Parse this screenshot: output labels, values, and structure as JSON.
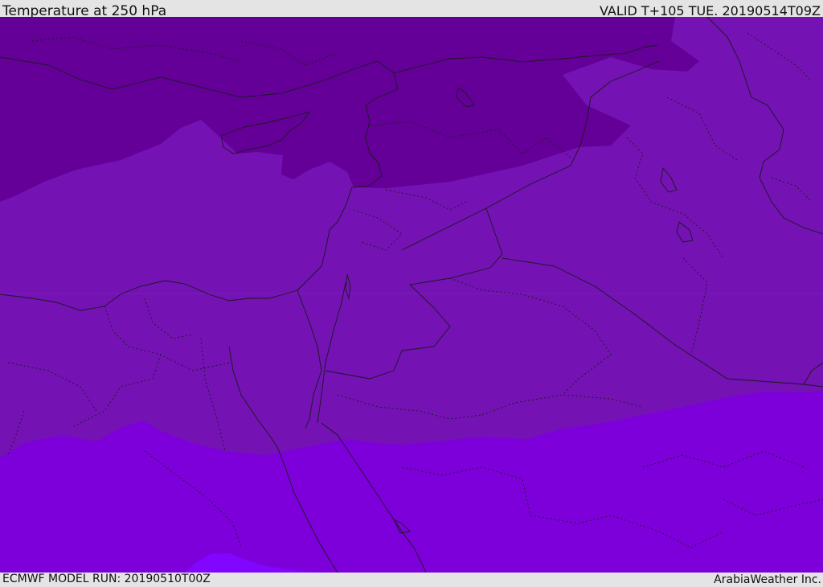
{
  "header": {
    "title": "Temperature at 250 hPa",
    "valid_time": "VALID T+105 TUE. 20190514T09Z"
  },
  "footer": {
    "model_run": "ECMWF MODEL RUN: 20190510T00Z",
    "credit": "ArabiaWeather Inc."
  },
  "colors": {
    "coldest_band": "#640098",
    "cold_band": "#7412b4",
    "mid_band": "#7d00db",
    "warm_band": "#8206ff",
    "boundary_line": "#1a1a1a"
  }
}
